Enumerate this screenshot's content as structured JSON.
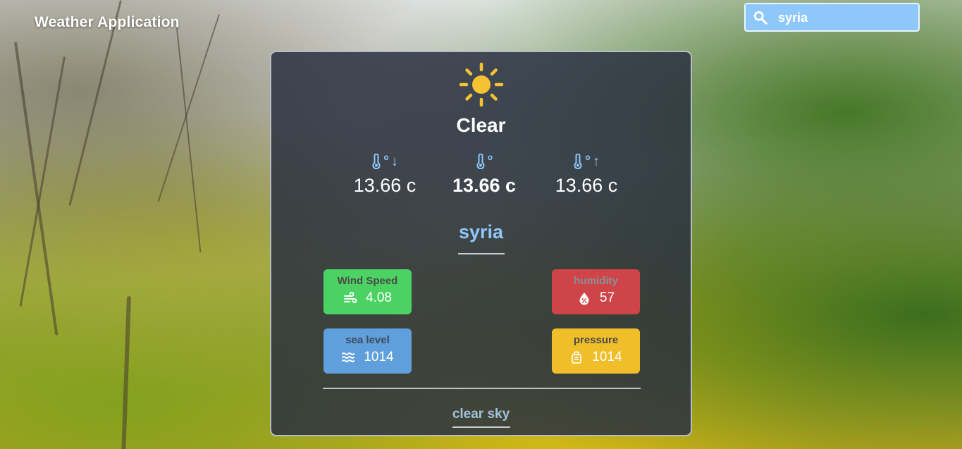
{
  "header": {
    "title": "Weather Application"
  },
  "search": {
    "value": "syria",
    "icon": "search-icon"
  },
  "weather": {
    "icon": "sun-icon",
    "condition": "Clear",
    "description": "clear sky",
    "city": "syria",
    "temperatures": {
      "min": {
        "label_arrow": "↓",
        "value": "13.66 c",
        "icon": "thermometer-icon"
      },
      "current": {
        "label_arrow": "",
        "value": "13.66 c",
        "icon": "thermometer-icon"
      },
      "max": {
        "label_arrow": "↑",
        "value": "13.66 c",
        "icon": "thermometer-icon"
      }
    },
    "stats": {
      "wind": {
        "label": "Wind Speed",
        "value": "4.08",
        "icon": "wind-icon",
        "color": "#4cd263"
      },
      "humidity": {
        "label": "humidity",
        "value": "57",
        "icon": "humidity-drop-icon",
        "color": "#cf4448"
      },
      "sea_level": {
        "label": "sea level",
        "value": "1014",
        "icon": "waves-icon",
        "color": "#5f9fdb"
      },
      "pressure": {
        "label": "pressure",
        "value": "1014",
        "icon": "pressure-gauge-icon",
        "color": "#f0be29"
      }
    }
  },
  "colors": {
    "accent": "#8ec8fb",
    "card_bg": "#282f3f",
    "sun": "#f5c233"
  }
}
